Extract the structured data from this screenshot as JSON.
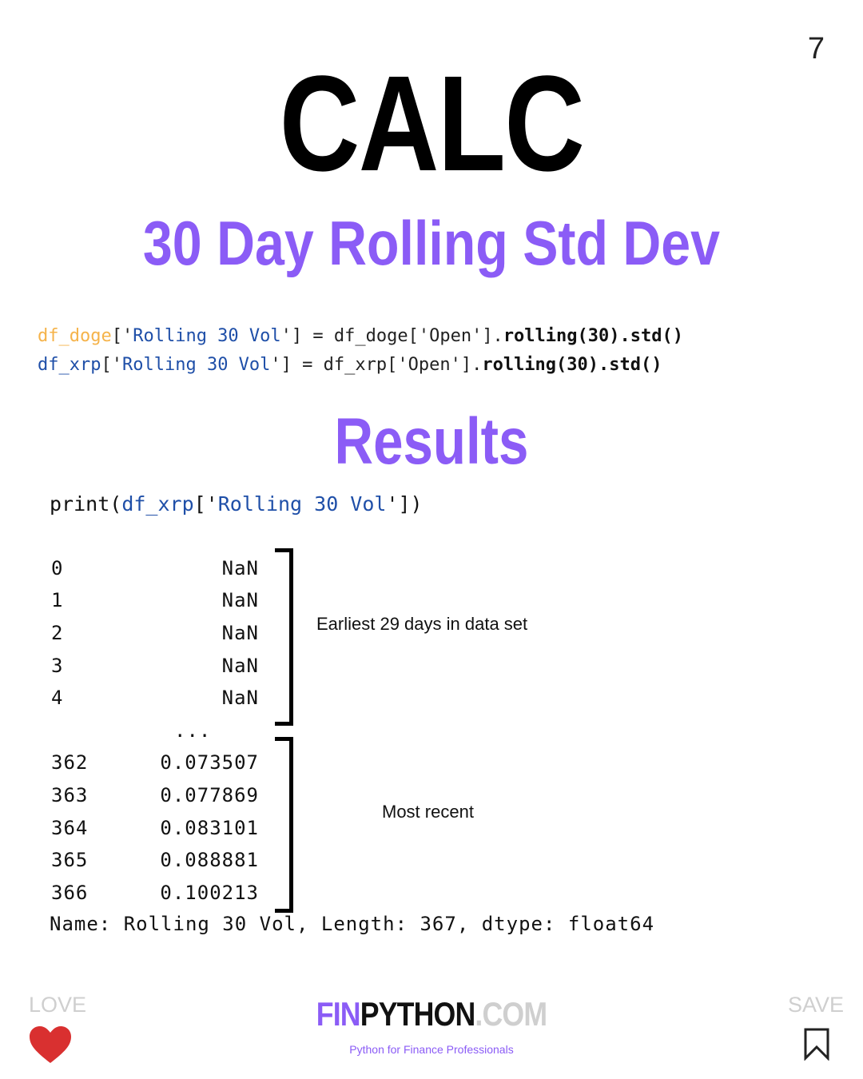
{
  "page_number": "7",
  "title": "CALC",
  "subtitle": "30 Day Rolling Std Dev",
  "code": {
    "line1": {
      "var": "df_doge",
      "open_bracket": "['",
      "key": "Rolling 30 Vol",
      "mid": "'] = df_doge['Open'].",
      "method": "rolling(30).std()"
    },
    "line2": {
      "var": "df_xrp",
      "open_bracket": "['",
      "key": "Rolling 30 Vol",
      "mid": "'] = df_xrp['Open'].",
      "method": "rolling(30).std()"
    }
  },
  "results_heading": "Results",
  "print_statement": {
    "prefix": "print(",
    "var": "df_xrp",
    "open": "['",
    "key": "Rolling 30 Vol",
    "close": "'])"
  },
  "output": {
    "rows_top": [
      {
        "index": "0",
        "value": "NaN"
      },
      {
        "index": "1",
        "value": "NaN"
      },
      {
        "index": "2",
        "value": "NaN"
      },
      {
        "index": "3",
        "value": "NaN"
      },
      {
        "index": "4",
        "value": "NaN"
      }
    ],
    "ellipsis": "...",
    "rows_bottom": [
      {
        "index": "362",
        "value": "0.073507"
      },
      {
        "index": "363",
        "value": "0.077869"
      },
      {
        "index": "364",
        "value": "0.083101"
      },
      {
        "index": "365",
        "value": "0.088881"
      },
      {
        "index": "366",
        "value": "0.100213"
      }
    ],
    "summary": "Name: Rolling 30 Vol, Length: 367, dtype: float64"
  },
  "annotations": {
    "earliest": "Earliest 29 days in data set",
    "recent": "Most recent"
  },
  "footer": {
    "love_label": "LOVE",
    "save_label": "SAVE",
    "brand_fin": "FIN",
    "brand_python": "PYTHON",
    "brand_com": ".COM",
    "tagline": "Python for Finance Professionals"
  },
  "colors": {
    "accent": "#8b5cf6",
    "orange": "#f5b34a",
    "blue": "#1f4fa8",
    "heart": "#d93030"
  }
}
